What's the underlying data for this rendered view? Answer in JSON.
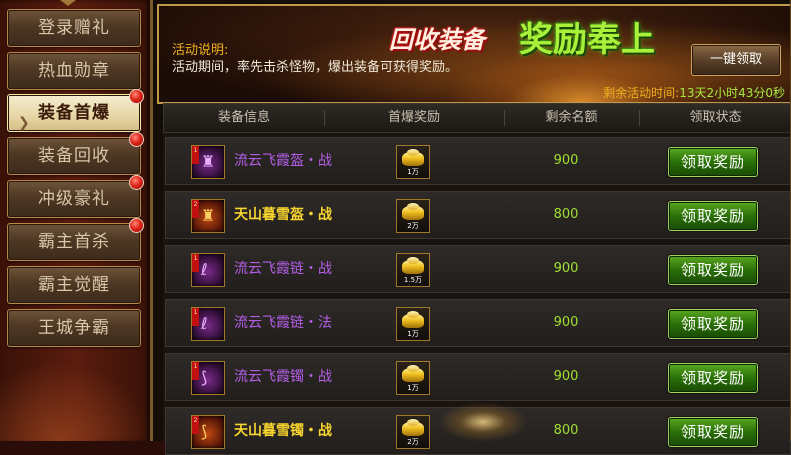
{
  "sidebar": {
    "items": [
      {
        "label": "登录赠礼",
        "active": false,
        "badge": false
      },
      {
        "label": "热血勋章",
        "active": false,
        "badge": false
      },
      {
        "label": "装备首爆",
        "active": true,
        "badge": true
      },
      {
        "label": "装备回收",
        "active": false,
        "badge": true
      },
      {
        "label": "冲级豪礼",
        "active": false,
        "badge": true
      },
      {
        "label": "霸主首杀",
        "active": false,
        "badge": true
      },
      {
        "label": "霸主觉醒",
        "active": false,
        "badge": false
      },
      {
        "label": "王城争霸",
        "active": false,
        "badge": false
      }
    ]
  },
  "banner": {
    "title_part1": "回收装备",
    "title_part2": "奖励奉上",
    "activity_label": "活动说明:",
    "activity_desc": "活动期间，率先击杀怪物，爆出装备可获得奖励。",
    "claim_all_label": "一键领取",
    "remaining_label": "剩余活动时间:",
    "remaining_value": "13天2小时43分0秒"
  },
  "table": {
    "headers": [
      "装备信息",
      "首爆奖励",
      "剩余名额",
      "领取状态"
    ],
    "rows": [
      {
        "name": "流云飞霞盔・战",
        "color": "purple",
        "rank": "1",
        "reward_qty": "1万",
        "remaining": "900",
        "action": "领取奖励"
      },
      {
        "name": "天山暮雪盔・战",
        "color": "yellow",
        "rank": "2",
        "reward_qty": "2万",
        "remaining": "800",
        "action": "领取奖励"
      },
      {
        "name": "流云飞霞链・战",
        "color": "purple",
        "rank": "1",
        "reward_qty": "1.5万",
        "remaining": "900",
        "action": "领取奖励"
      },
      {
        "name": "流云飞霞链・法",
        "color": "purple",
        "rank": "1",
        "reward_qty": "1万",
        "remaining": "900",
        "action": "领取奖励"
      },
      {
        "name": "流云飞霞镯・战",
        "color": "purple",
        "rank": "1",
        "reward_qty": "1万",
        "remaining": "900",
        "action": "领取奖励"
      },
      {
        "name": "天山暮雪镯・战",
        "color": "yellow",
        "rank": "2",
        "reward_qty": "2万",
        "remaining": "800",
        "action": "领取奖励"
      }
    ]
  },
  "colors": {
    "purple_item": "#b45ee8",
    "yellow_item": "#f8d430",
    "remaining_green": "#a0e030",
    "claim_green": "#2a7008",
    "gold_label": "#f0b020"
  },
  "icons": {
    "equipment": "equipment-icon",
    "reward": "gold-ingot-icon",
    "badge": "red-notification-dot"
  }
}
